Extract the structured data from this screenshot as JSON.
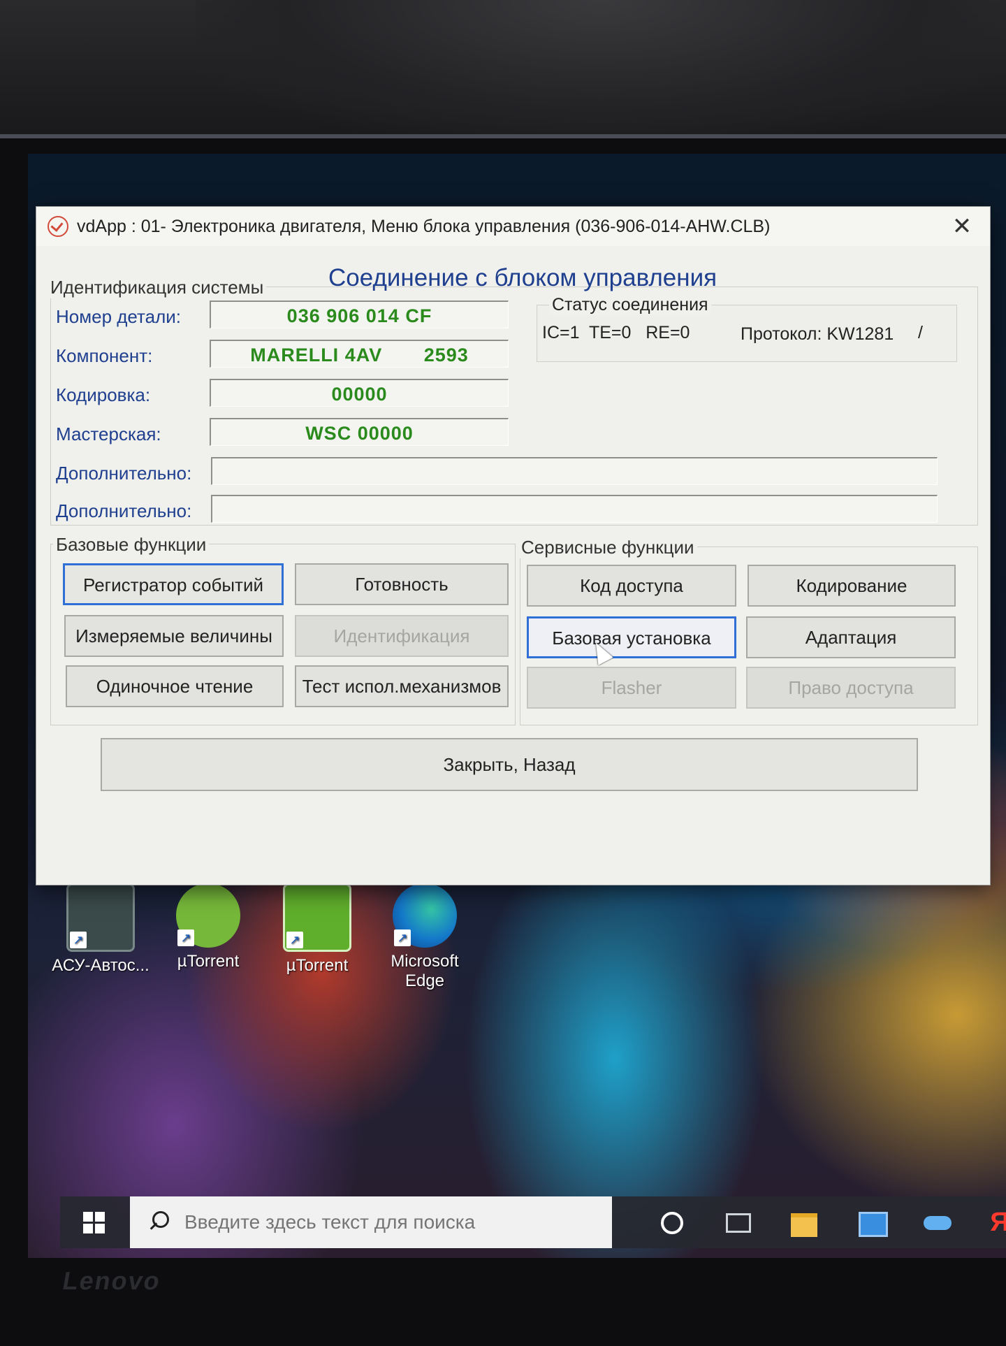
{
  "dialog": {
    "title": "vdApp : 01- Электроника двигателя,  Меню блока управления (036-906-014-AHW.CLB)",
    "close_symbol": "✕",
    "connection_header": "Соединение с блоком управления"
  },
  "identification": {
    "title": "Идентификация системы",
    "fields": [
      {
        "label": "Номер детали:",
        "value": "036 906 014 CF"
      },
      {
        "label": "Компонент:",
        "value": "MARELLI 4AV       2593"
      },
      {
        "label": "Кодировка:",
        "value": "00000"
      },
      {
        "label": "Мастерская:",
        "value": "WSC 00000"
      },
      {
        "label": "Дополнительно:",
        "value": ""
      },
      {
        "label": "Дополнительно:",
        "value": ""
      }
    ],
    "value_color": "#2a8a1c",
    "label_color": "#1f3f8f"
  },
  "connection_status": {
    "title": "Статус соединения",
    "counters": "IC=1  TE=0   RE=0",
    "protocol": "Протокол: KW1281",
    "trailing": "/"
  },
  "basic_functions": {
    "title": "Базовые функции",
    "buttons": [
      {
        "label": "Регистратор событий",
        "state": "focused"
      },
      {
        "label": "Готовность",
        "state": "normal"
      },
      {
        "label": "Измеряемые величины",
        "state": "normal"
      },
      {
        "label": "Идентификация",
        "state": "disabled"
      },
      {
        "label": "Одиночное чтение",
        "state": "normal"
      },
      {
        "label": "Тест испол.механизмов",
        "state": "normal"
      }
    ]
  },
  "service_functions": {
    "title": "Сервисные функции",
    "buttons": [
      {
        "label": "Код доступа",
        "state": "normal"
      },
      {
        "label": "Кодирование",
        "state": "normal"
      },
      {
        "label": "Базовая установка",
        "state": "selected"
      },
      {
        "label": "Адаптация",
        "state": "normal"
      },
      {
        "label": "Flasher",
        "state": "disabled"
      },
      {
        "label": "Право доступа",
        "state": "disabled"
      }
    ]
  },
  "close_back_button": "Закрыть, Назад",
  "desktop": {
    "icons": [
      {
        "label": "АСУ-Автос...",
        "icon": "car-diagnostic-icon"
      },
      {
        "label": "µTorrent",
        "icon": "utorrent-icon"
      },
      {
        "label": "µTorrent",
        "icon": "utorrent-icon"
      },
      {
        "label": "Microsoft Edge",
        "icon": "edge-icon"
      }
    ],
    "accent": "#1fa0c9"
  },
  "taskbar": {
    "search_placeholder": "Введите здесь текст для поиска",
    "yandex_glyph": "Я"
  },
  "laptop": {
    "brand": "Lenovo"
  }
}
